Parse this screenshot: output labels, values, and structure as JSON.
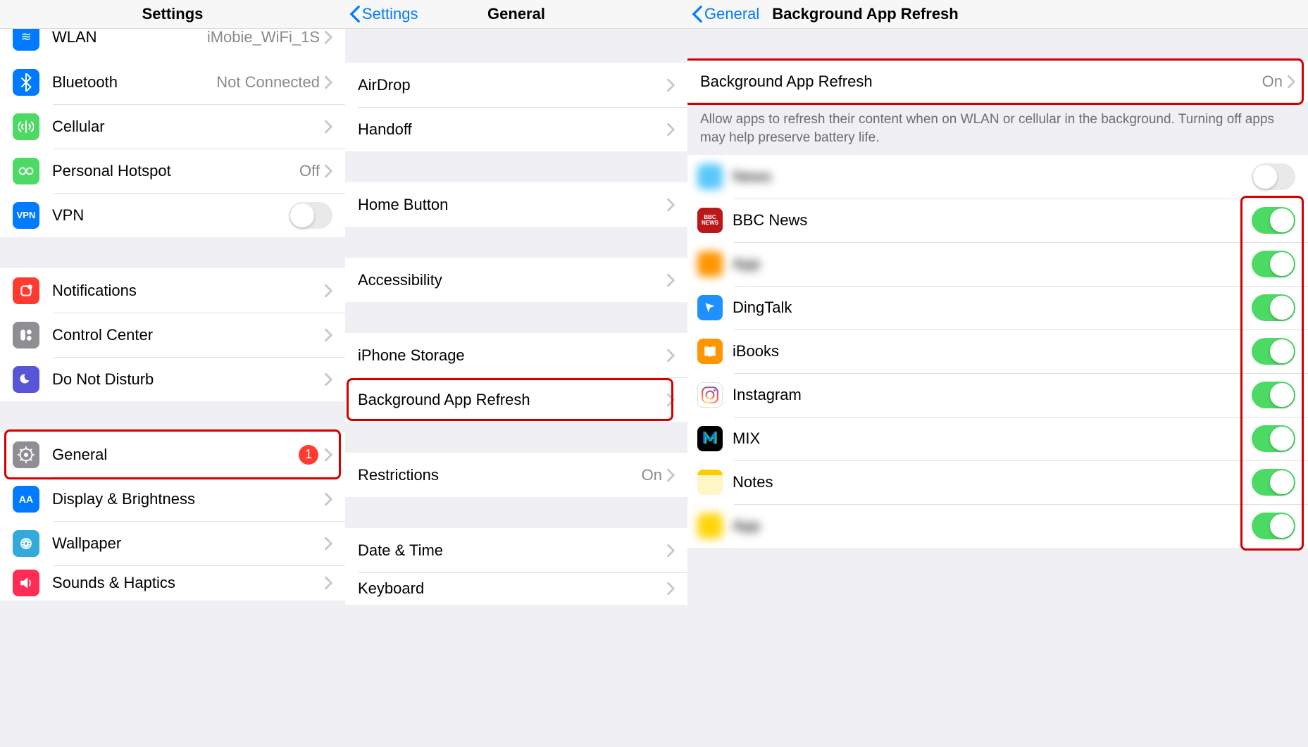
{
  "pane1": {
    "title": "Settings",
    "rows": [
      {
        "icon": "wlan",
        "icon_bg": "#007aff",
        "label": "WLAN",
        "value": "iMobie_WiFi_1S",
        "chevron": true,
        "cut": true
      },
      {
        "icon": "bluetooth",
        "icon_bg": "#007aff",
        "label": "Bluetooth",
        "value": "Not Connected",
        "chevron": true
      },
      {
        "icon": "cellular",
        "icon_bg": "#4cd964",
        "label": "Cellular",
        "value": "",
        "chevron": true
      },
      {
        "icon": "hotspot",
        "icon_bg": "#4cd964",
        "label": "Personal Hotspot",
        "value": "Off",
        "chevron": true
      },
      {
        "icon": "vpn",
        "icon_bg": "#007aff",
        "label": "VPN",
        "toggle": false
      }
    ],
    "rows2": [
      {
        "icon": "notifications",
        "icon_bg": "#ff3b30",
        "label": "Notifications",
        "chevron": true
      },
      {
        "icon": "controlcenter",
        "icon_bg": "#8e8e93",
        "label": "Control Center",
        "chevron": true
      },
      {
        "icon": "dnd",
        "icon_bg": "#5856d6",
        "label": "Do Not Disturb",
        "chevron": true
      }
    ],
    "rows3": [
      {
        "icon": "general",
        "icon_bg": "#8e8e93",
        "label": "General",
        "badge": "1",
        "chevron": true,
        "highlight": true
      },
      {
        "icon": "display",
        "icon_bg": "#007aff",
        "label": "Display & Brightness",
        "chevron": true
      },
      {
        "icon": "wallpaper",
        "icon_bg": "#34aadc",
        "label": "Wallpaper",
        "chevron": true
      },
      {
        "icon": "sounds",
        "icon_bg": "#ff2d55",
        "label": "Sounds & Haptics",
        "chevron": true
      }
    ]
  },
  "pane2": {
    "back": "Settings",
    "title": "General",
    "groups": [
      [
        {
          "label": "AirDrop",
          "chevron": true
        },
        {
          "label": "Handoff",
          "chevron": true
        }
      ],
      [
        {
          "label": "Home Button",
          "chevron": true
        }
      ],
      [
        {
          "label": "Accessibility",
          "chevron": true
        }
      ],
      [
        {
          "label": "iPhone Storage",
          "chevron": true
        },
        {
          "label": "Background App Refresh",
          "chevron": true,
          "highlight": true
        }
      ],
      [
        {
          "label": "Restrictions",
          "value": "On",
          "chevron": true
        }
      ],
      [
        {
          "label": "Date & Time",
          "chevron": true
        },
        {
          "label": "Keyboard",
          "chevron": true
        }
      ]
    ]
  },
  "pane3": {
    "back": "General",
    "title": "Background App Refresh",
    "master": {
      "label": "Background App Refresh",
      "value": "On",
      "chevron": true,
      "highlight": true
    },
    "footer": "Allow apps to refresh their content when on WLAN or cellular in the background. Turning off apps may help preserve battery life.",
    "apps": [
      {
        "label": "News",
        "icon_bg": "#5ac8fa",
        "toggle": false,
        "blur": true
      },
      {
        "label": "BBC News",
        "icon_bg": "#bb1919",
        "toggle": true
      },
      {
        "label": "App",
        "icon_bg": "#ff9500",
        "toggle": true,
        "blur": true
      },
      {
        "label": "DingTalk",
        "icon_bg": "#1e90ff",
        "toggle": true
      },
      {
        "label": "iBooks",
        "icon_bg": "#ff9500",
        "toggle": true
      },
      {
        "label": "Instagram",
        "icon_bg": "#ffffff",
        "toggle": true,
        "insta": true
      },
      {
        "label": "MIX",
        "icon_bg": "#000000",
        "toggle": true,
        "mix": true
      },
      {
        "label": "Notes",
        "icon_bg": "#fff6c5",
        "toggle": true,
        "notes": true
      },
      {
        "label": "App",
        "icon_bg": "#ffd60a",
        "toggle": true,
        "blur": true
      }
    ]
  }
}
